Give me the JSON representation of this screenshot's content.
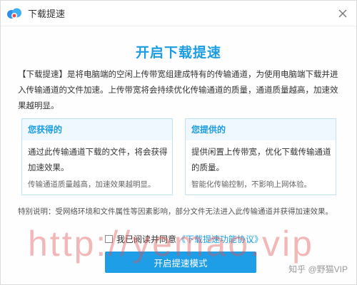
{
  "window": {
    "title": "下载提速"
  },
  "heading": "开启下载提速",
  "intro": "【下载提速】是将电脑端的空闲上传带宽组建成特有的传输通道，为使用电脑端下载并进入传输通道的文件加速。上传带宽将会持续优化传输通道的质量，通道质量越高，加速效果越明显。",
  "cards": {
    "left": {
      "title": "您获得的",
      "body": "通过此传输通道下载的文件，将会获得加速效果。",
      "note": "传输通道质量越高，加速效果越明显。"
    },
    "right": {
      "title": "您提供的",
      "body": "提供闲置上传带宽，优化下载传输通道的质量。",
      "note": "智能化传输控制，不影响上网体验。"
    }
  },
  "special_note": "特别说明：受网络环境和文件属性等因素影响，部分文件无法进入此传输通道并获得加速效果。",
  "agreement": {
    "prefix": "我已阅读并同意",
    "link": "《下载提速功能协议》"
  },
  "button": {
    "label": "开启提速模式"
  },
  "watermarks": {
    "big": "http://yemao.vip",
    "small": "知乎 @野猫VIP"
  },
  "colors": {
    "accent": "#1c9ce3",
    "button": "#1f9ee8",
    "card_border": "#bfe2f7",
    "card_header": "#eef8fe"
  },
  "icons": {
    "logo": "baidu-netdisk-logo-icon",
    "close": "close-icon"
  }
}
